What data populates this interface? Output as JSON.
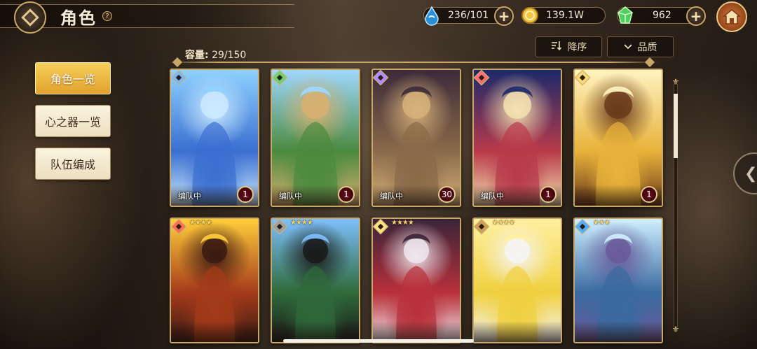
{
  "header": {
    "title": "角色",
    "help_glyph": "?",
    "resources": [
      {
        "name": "stamina",
        "value": "236/101",
        "icon": "water-drop-icon",
        "color": "#3fa8e0",
        "has_plus": true
      },
      {
        "name": "gold",
        "value": "139.1W",
        "icon": "coin-icon",
        "color": "#e7b93b",
        "has_plus": false
      },
      {
        "name": "gems",
        "value": "962",
        "icon": "green-crystal-icon",
        "color": "#4fcf5f",
        "has_plus": true
      }
    ],
    "plus_glyph": "+"
  },
  "toolbar": {
    "capacity_label": "容量:",
    "capacity_value": "29/150",
    "sort_order_label": "降序",
    "sort_order_icon": "sort-descending-icon",
    "filter_label": "品质",
    "filter_icon": "chevron-down-icon"
  },
  "menu": {
    "items": [
      {
        "label": "角色一览",
        "active": true
      },
      {
        "label": "心之器一览",
        "active": false
      },
      {
        "label": "队伍编成",
        "active": false
      }
    ]
  },
  "cards": [
    {
      "team_tag": "编队中",
      "level": "1",
      "stars": "",
      "element_color": "#7fb7ff",
      "palette": [
        "#8fd1ff",
        "#3a6fd0",
        "#cdeaff"
      ]
    },
    {
      "team_tag": "编队中",
      "level": "1",
      "stars": "",
      "element_color": "#6fd06f",
      "palette": [
        "#9fd8ff",
        "#4b8a3f",
        "#d8b070"
      ]
    },
    {
      "team_tag": "编队中",
      "level": "30",
      "stars": "",
      "element_color": "#b58cff",
      "palette": [
        "#3c2a3a",
        "#8a6a4a",
        "#d7b17a"
      ]
    },
    {
      "team_tag": "编队中",
      "level": "1",
      "stars": "",
      "element_color": "#ff6f6f",
      "palette": [
        "#1c2a6a",
        "#b83a4a",
        "#f4e0b0"
      ]
    },
    {
      "team_tag": "",
      "level": "1",
      "stars": "",
      "element_color": "#ffd86f",
      "palette": [
        "#fff3c0",
        "#e8b23a",
        "#6a3a1a"
      ]
    },
    {
      "team_tag": "",
      "level": "",
      "stars": "★★★★",
      "element_color": "#ff6f4f",
      "palette": [
        "#ffcf3a",
        "#a43a1a",
        "#3a1a12"
      ]
    },
    {
      "team_tag": "",
      "level": "",
      "stars": "★★★★",
      "element_color": "#a0a0a0",
      "palette": [
        "#7ec0ff",
        "#2f6a3a",
        "#1a1a1a"
      ]
    },
    {
      "team_tag": "",
      "level": "",
      "stars": "★★★★",
      "element_color": "#ffe07f",
      "palette": [
        "#3a2438",
        "#b8303a",
        "#f0e6ee"
      ]
    },
    {
      "team_tag": "",
      "level": "",
      "stars": "★★★★",
      "element_color": "#d0a050",
      "palette": [
        "#fff0a0",
        "#f0d040",
        "#f4f4f4"
      ]
    },
    {
      "team_tag": "",
      "level": "",
      "stars": "★★★",
      "element_color": "#4fb0ff",
      "palette": [
        "#d0f0ff",
        "#3a6aa0",
        "#6a5a9a"
      ]
    }
  ],
  "scrollbar": {
    "position": 0.05,
    "visible_fraction": 0.27,
    "cap_glyph": "⚜"
  },
  "side_handle_glyph": "❮"
}
